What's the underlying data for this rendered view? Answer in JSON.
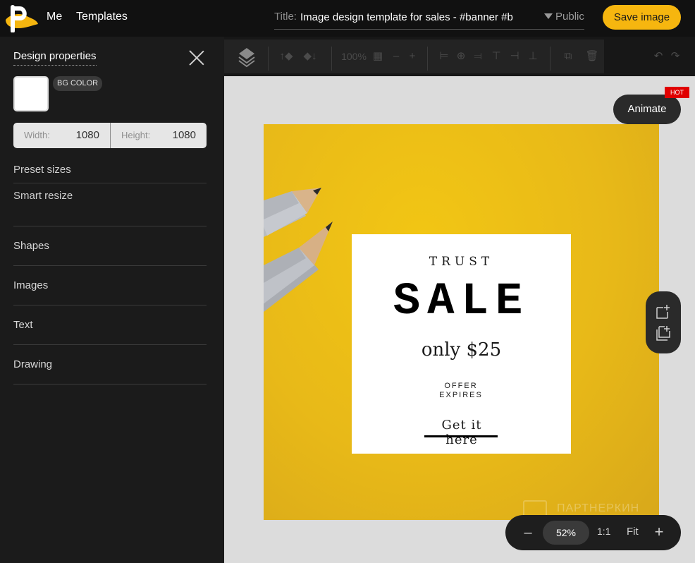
{
  "app": {
    "name": "Pixelixe"
  },
  "header": {
    "nav": [
      {
        "label": "Me"
      },
      {
        "label": "Templates"
      }
    ],
    "title_label": "Title:",
    "title_value": "Image design template for sales - #banner #b",
    "visibility": "Public",
    "save_label": "Save image"
  },
  "left_panel": {
    "title": "Design properties",
    "bg_color_label": "BG COLOR",
    "bg_color": "#ffffff",
    "width_label": "Width:",
    "width_value": "1080",
    "height_label": "Height:",
    "height_value": "1080",
    "links": [
      {
        "label": "Preset sizes"
      },
      {
        "label": "Smart resize"
      }
    ],
    "sections": [
      {
        "label": "Shapes"
      },
      {
        "label": "Images"
      },
      {
        "label": "Text"
      },
      {
        "label": "Drawing"
      }
    ]
  },
  "toolbar": {
    "zoom_text": "100%",
    "icons": [
      "layers-icon",
      "bring-forward-icon",
      "send-backward-icon",
      "zoom-icon",
      "transparency-icon",
      "minus-icon",
      "plus-icon",
      "align-left-icon",
      "align-center-icon",
      "align-right-icon",
      "align-top-icon",
      "align-middle-icon",
      "align-bottom-icon",
      "duplicate-icon",
      "delete-icon",
      "undo-icon",
      "redo-icon"
    ]
  },
  "design": {
    "background_color": "#e8b918",
    "card": {
      "trust": "TRUST",
      "sale": "SALE",
      "price": "only $25",
      "offer_line1": "OFFER",
      "offer_line2": "EXPIRES",
      "cta": "Get it here"
    }
  },
  "animate": {
    "label": "Animate",
    "badge": "HOT"
  },
  "watermark": {
    "text": "ПАРТНЕРКИН"
  },
  "zoom_bar": {
    "value": "52%",
    "one_to_one": "1:1",
    "fit": "Fit"
  },
  "colors": {
    "accent": "#f6b60f",
    "topbar": "#111111",
    "panel": "#1b1b1b",
    "hot": "#e00000"
  }
}
